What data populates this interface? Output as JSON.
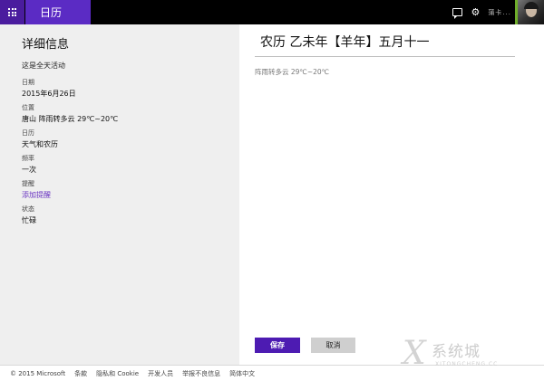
{
  "app": {
    "title": "日历"
  },
  "topbar": {
    "user_name": "蒲卡..."
  },
  "sidebar": {
    "title": "详细信息",
    "all_day": "这是全天活动",
    "fields": [
      {
        "label": "日期",
        "value": "2015年6月26日"
      },
      {
        "label": "位置",
        "value": "唐山 阵雨转多云 29℃~20℃"
      },
      {
        "label": "日历",
        "value": "天气和农历"
      },
      {
        "label": "频率",
        "value": "一次"
      },
      {
        "label": "提醒",
        "value": "添加提醒"
      },
      {
        "label": "状态",
        "value": "忙碌"
      }
    ]
  },
  "main": {
    "title": "农历 乙未年【羊年】五月十一",
    "weather": "阵雨转多云 29℃~20℃",
    "save_label": "保存",
    "cancel_label": "取消"
  },
  "footer": {
    "links": [
      "© 2015 Microsoft",
      "条款",
      "隐私和 Cookie",
      "开发人员",
      "举报不良信息",
      "简体中文"
    ]
  },
  "watermark": {
    "cn": "系统城",
    "en": "XITONGCHENG.CC"
  },
  "colors": {
    "accent": "#5b2bc4",
    "save": "#4d1bb2",
    "topbar": "#000000",
    "sidebar": "#efefef"
  }
}
